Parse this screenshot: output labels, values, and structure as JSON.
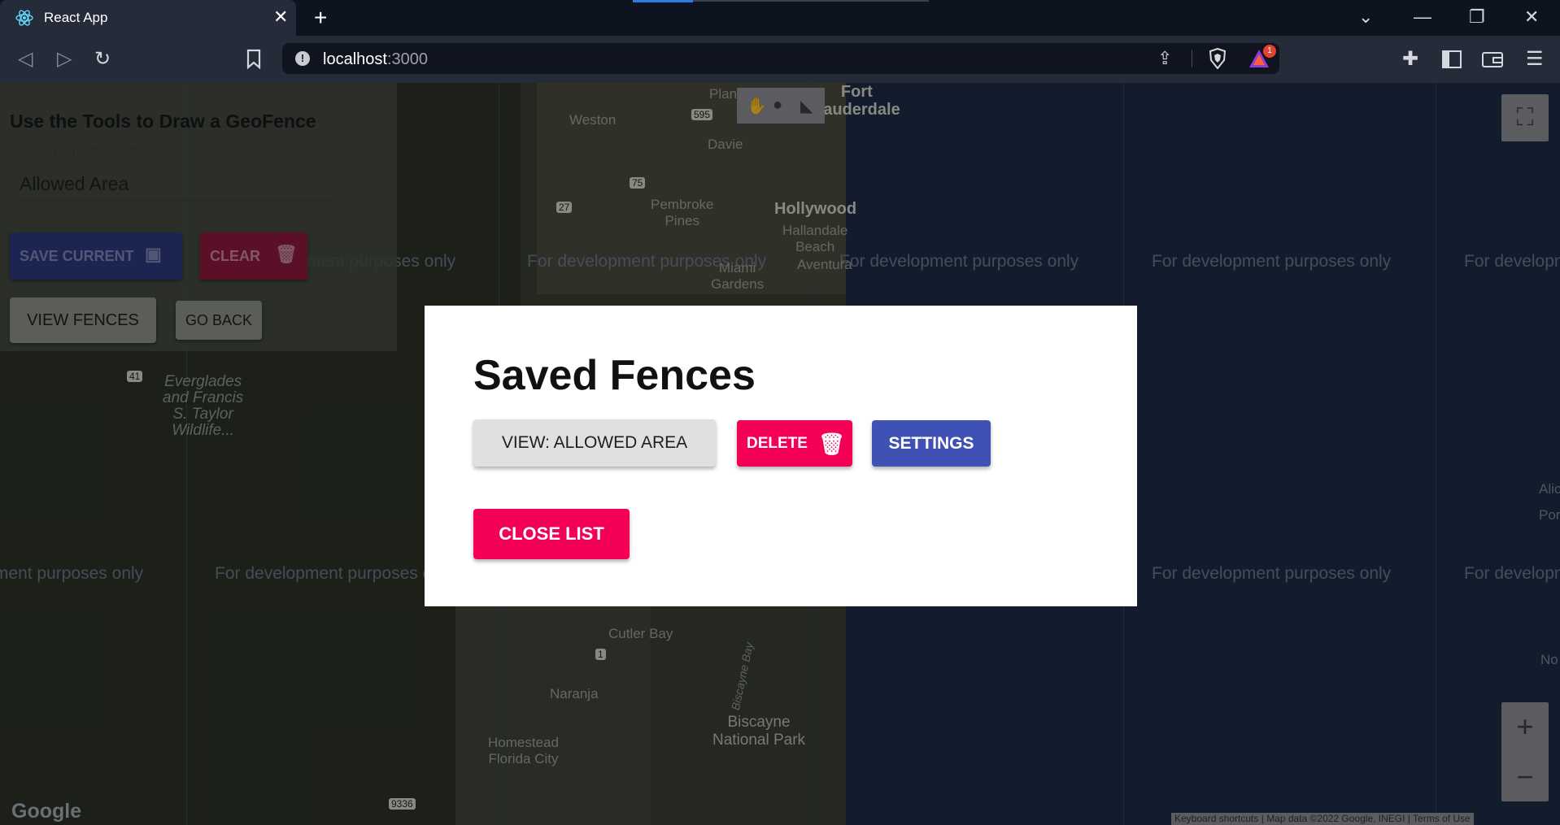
{
  "browser": {
    "tab_title": "React App",
    "url_host": "localhost",
    "url_port": ":3000",
    "notification_count": "1",
    "colors": {
      "accent": "#2f7ae5",
      "badge": "#e0442f"
    }
  },
  "map": {
    "watermark": "For development purposes only",
    "labels": {
      "weston": "Weston",
      "davie": "Davie",
      "hollywood": "Hollywood",
      "pembroke_pines": "Pembroke\nPines",
      "hallandale": "Hallandale\nBeach",
      "miami_gardens": "Miami\nGardens",
      "aventura": "Aventura",
      "fort_lauderdale": "Fort\nLauderdale",
      "plantation": "Plan",
      "everglades": "Everglades\nand Francis\nS. Taylor\nWildlife...",
      "cutler_bay": "Cutler Bay",
      "naranja": "Naranja",
      "homestead": "Homestead\nFlorida City",
      "biscayne": "Biscayne\nNational Park",
      "biscayne_bay": "Biscayne Bay",
      "highway_41": "41",
      "highway_75": "75",
      "highway_27": "27",
      "highway_595": "595",
      "highway_1": "1",
      "highway_9336": "9336",
      "right_edge_1": "Alic",
      "right_edge_2": "Por",
      "right_edge_3": "No"
    },
    "google_logo": "Google",
    "keyboard_shortcuts": "Keyboard shortcuts",
    "map_data": "Map data ©2022 Google, INEGI",
    "terms": "Terms of Use"
  },
  "panel": {
    "heading": "Use the Tools to Draw a GeoFence",
    "field_label": "Enter name for Geofence",
    "field_value": "Allowed Area",
    "save_label": "SAVE CURRENT",
    "clear_label": "CLEAR",
    "view_fences_label": "VIEW FENCES",
    "go_back_label": "GO BACK"
  },
  "dialog": {
    "title": "Saved Fences",
    "view_label": "VIEW: ALLOWED AREA",
    "delete_label": "DELETE",
    "settings_label": "SETTINGS",
    "close_label": "CLOSE LIST",
    "colors": {
      "pink": "#f50057",
      "indigo": "#3f51b5",
      "grey": "#e0e0e0"
    }
  }
}
